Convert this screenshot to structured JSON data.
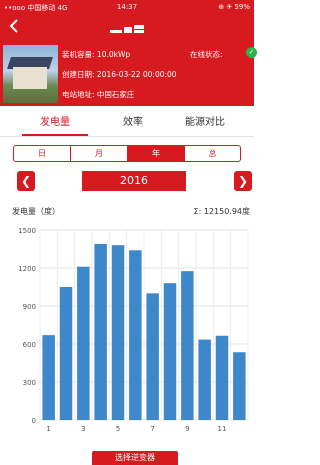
{
  "status_bar": {
    "signal": "••ooo",
    "carrier": "中国移动",
    "network": "4G",
    "time": "14:37",
    "right_icons": "⊕ ✈ 59%"
  },
  "nav": {
    "back_icon": "chevron-left-icon"
  },
  "station": {
    "capacity_label": "装机容量:",
    "capacity_value": "10.0kWp",
    "date_label": "创建日期:",
    "date_value": "2016-03-22 00:00:00",
    "address_label": "电站地址:",
    "address_value": "中国石家庄",
    "online_label": "在线状态:",
    "online_icon": "check-circle-icon"
  },
  "tabs": [
    {
      "label": "发电量",
      "active": true
    },
    {
      "label": "效率",
      "active": false
    },
    {
      "label": "能源对比",
      "active": false
    }
  ],
  "period_segments": [
    {
      "label": "日",
      "active": false
    },
    {
      "label": "月",
      "active": false
    },
    {
      "label": "年",
      "active": true
    },
    {
      "label": "总",
      "active": false
    }
  ],
  "year_selector": {
    "value": "2016",
    "prev": "❮",
    "next": "❯"
  },
  "chart_header": {
    "left_label": "发电量（度）",
    "total_prefix": "Σ:",
    "total_value": "12150.94度"
  },
  "chart_data": {
    "type": "bar",
    "categories": [
      1,
      2,
      3,
      4,
      5,
      6,
      7,
      8,
      9,
      10,
      11,
      12
    ],
    "values": [
      670,
      1050,
      1210,
      1390,
      1380,
      1340,
      1000,
      1080,
      1175,
      635,
      665,
      535
    ],
    "ylim": [
      0,
      1500
    ],
    "yticks": [
      0,
      300,
      600,
      900,
      1200,
      1500
    ],
    "xtick_labels": [
      "1",
      "3",
      "5",
      "7",
      "9",
      "11"
    ],
    "xtick_positions": [
      1,
      3,
      5,
      7,
      9,
      11
    ],
    "bar_color": "#3d87cb",
    "grid": true
  },
  "select_button": {
    "label": "选择逆变器"
  },
  "colors": {
    "brand": "#d71920",
    "online": "#2bb24c",
    "bar": "#3d87cb"
  }
}
